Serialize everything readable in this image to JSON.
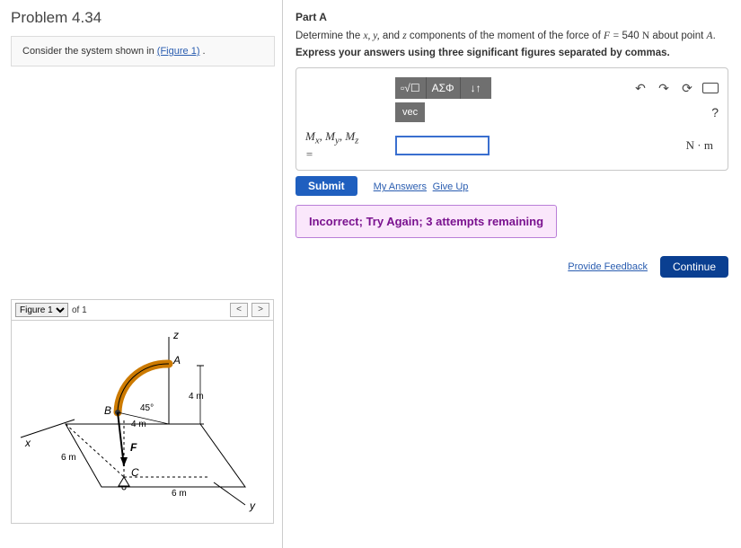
{
  "problem": {
    "title": "Problem 4.34",
    "consider_prefix": "Consider the system shown in ",
    "consider_link": "(Figure 1)",
    "consider_suffix": " ."
  },
  "figure": {
    "selected": "Figure 1",
    "of_text": "of 1",
    "labels": {
      "z": "z",
      "x": "x",
      "y": "y",
      "A": "A",
      "B": "B",
      "C": "C",
      "F": "F",
      "angle": "45°",
      "d4a": "4 m",
      "d4b": "4 m",
      "d6a": "6 m",
      "d6b": "6 m"
    }
  },
  "partA": {
    "heading": "Part A",
    "prompt_pre": "Determine the ",
    "prompt_vars": "x, y,",
    "prompt_mid": " and ",
    "prompt_var_z": "z",
    "prompt_rest": " components of the moment of the force of ",
    "F_lhs": "F = ",
    "F_val": "540",
    "F_unit": "N",
    "prompt_tail": " about point ",
    "point": "A",
    "instruction": "Express your answers using three significant figures separated by commas.",
    "toolbar": {
      "templates": "▫√☐",
      "greek": "ΑΣΦ",
      "updown": "↓↑",
      "undo": "↶",
      "redo": "↷",
      "reset": "⟳",
      "vec": "vec",
      "help": "?"
    },
    "label_html": "M<sub>x</sub>, M<sub>y</sub>, M<sub>z</sub><br>=",
    "answer_value": "",
    "units": "N · m",
    "submit_label": "Submit",
    "my_answers": "My Answers",
    "give_up": "Give Up",
    "feedback": "Incorrect; Try Again; 3 attempts remaining",
    "provide_feedback": "Provide Feedback",
    "continue": "Continue"
  }
}
